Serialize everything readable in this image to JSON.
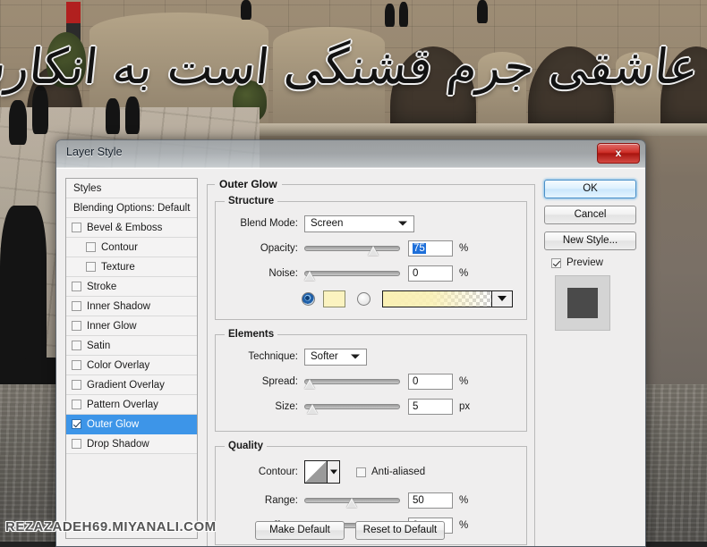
{
  "background": {
    "calligraphy_text": "عاشقی جرم قشنگی است به انکارش نکوش",
    "watermark": "REZAZADEH69.MIYANALI.COM"
  },
  "dialog": {
    "title": "Layer Style",
    "close_label": "x"
  },
  "styles_list": [
    {
      "label": "Styles",
      "type": "header",
      "checked": false,
      "indent": false,
      "selected": false
    },
    {
      "label": "Blending Options: Default",
      "type": "header",
      "checked": false,
      "indent": false,
      "selected": false
    },
    {
      "label": "Bevel & Emboss",
      "type": "checkbox",
      "checked": false,
      "indent": false,
      "selected": false
    },
    {
      "label": "Contour",
      "type": "checkbox",
      "checked": false,
      "indent": true,
      "selected": false
    },
    {
      "label": "Texture",
      "type": "checkbox",
      "checked": false,
      "indent": true,
      "selected": false
    },
    {
      "label": "Stroke",
      "type": "checkbox",
      "checked": false,
      "indent": false,
      "selected": false
    },
    {
      "label": "Inner Shadow",
      "type": "checkbox",
      "checked": false,
      "indent": false,
      "selected": false
    },
    {
      "label": "Inner Glow",
      "type": "checkbox",
      "checked": false,
      "indent": false,
      "selected": false
    },
    {
      "label": "Satin",
      "type": "checkbox",
      "checked": false,
      "indent": false,
      "selected": false
    },
    {
      "label": "Color Overlay",
      "type": "checkbox",
      "checked": false,
      "indent": false,
      "selected": false
    },
    {
      "label": "Gradient Overlay",
      "type": "checkbox",
      "checked": false,
      "indent": false,
      "selected": false
    },
    {
      "label": "Pattern Overlay",
      "type": "checkbox",
      "checked": false,
      "indent": false,
      "selected": false
    },
    {
      "label": "Outer Glow",
      "type": "checkbox",
      "checked": true,
      "indent": false,
      "selected": true
    },
    {
      "label": "Drop Shadow",
      "type": "checkbox",
      "checked": false,
      "indent": false,
      "selected": false
    }
  ],
  "panel": {
    "title": "Outer Glow",
    "structure": {
      "legend": "Structure",
      "blend_mode_label": "Blend Mode:",
      "blend_mode_value": "Screen",
      "opacity_label": "Opacity:",
      "opacity_value": "75",
      "opacity_unit": "%",
      "opacity_percent": 75,
      "noise_label": "Noise:",
      "noise_value": "0",
      "noise_unit": "%",
      "noise_percent": 0,
      "fill_type": "color",
      "color_hex": "#fbf3c0",
      "gradient_from_hex": "#faf0b4",
      "gradient_to": "transparent"
    },
    "elements": {
      "legend": "Elements",
      "technique_label": "Technique:",
      "technique_value": "Softer",
      "spread_label": "Spread:",
      "spread_value": "0",
      "spread_unit": "%",
      "spread_percent": 0,
      "size_label": "Size:",
      "size_value": "5",
      "size_unit": "px",
      "size_percent": 3
    },
    "quality": {
      "legend": "Quality",
      "contour_label": "Contour:",
      "antialiased_label": "Anti-aliased",
      "antialiased_checked": false,
      "range_label": "Range:",
      "range_value": "50",
      "range_unit": "%",
      "range_percent": 50,
      "jitter_label": "Jitter:",
      "jitter_value": "0",
      "jitter_unit": "%",
      "jitter_percent": 0
    }
  },
  "buttons": {
    "ok": "OK",
    "cancel": "Cancel",
    "new_style": "New Style...",
    "preview_label": "Preview",
    "preview_checked": true,
    "make_default": "Make Default",
    "reset_to_default": "Reset to Default"
  },
  "colors": {
    "accent_selection": "#3d95e8",
    "dialog_bg": "#efeeee",
    "close_red": "#cf2f28"
  }
}
